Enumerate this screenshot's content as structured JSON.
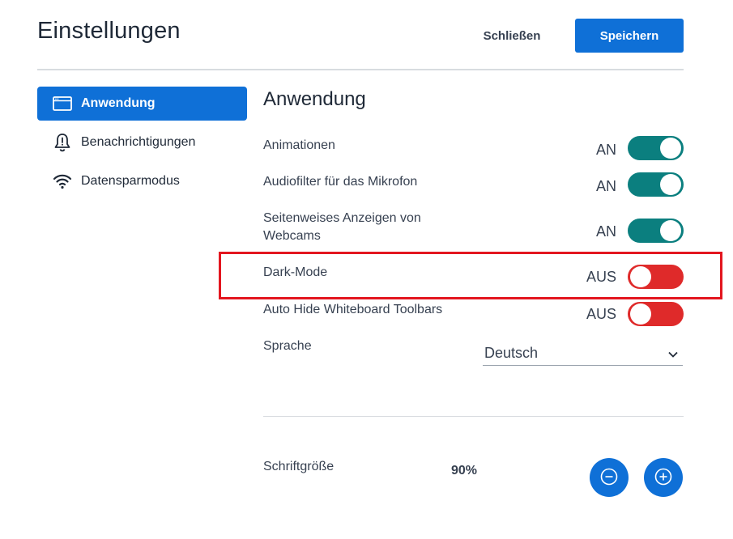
{
  "header": {
    "title": "Einstellungen",
    "close_label": "Schließen",
    "save_label": "Speichern"
  },
  "sidebar": {
    "items": [
      {
        "label": "Anwendung",
        "icon": "application-window-icon",
        "active": true
      },
      {
        "label": "Benachrichtigungen",
        "icon": "bell-icon",
        "active": false
      },
      {
        "label": "Datensparmodus",
        "icon": "wifi-icon",
        "active": false
      }
    ]
  },
  "main": {
    "section_title": "Anwendung",
    "settings": [
      {
        "label": "Animationen",
        "state": "AN",
        "on": true
      },
      {
        "label": "Audiofilter für das Mikrofon",
        "state": "AN",
        "on": true
      },
      {
        "label": "Seitenweises Anzeigen von Webcams",
        "state": "AN",
        "on": true
      },
      {
        "label": "Dark-Mode",
        "state": "AUS",
        "on": false
      },
      {
        "label": "Auto Hide Whiteboard Toolbars",
        "state": "AUS",
        "on": false
      }
    ],
    "language": {
      "label": "Sprache",
      "value": "Deutsch"
    },
    "font_size": {
      "label": "Schriftgröße",
      "value": "90%"
    }
  },
  "colors": {
    "primary": "#0f70d7",
    "toggle_on": "#0b7f7f",
    "toggle_off": "#df2a2a",
    "highlight": "#e3161f"
  }
}
